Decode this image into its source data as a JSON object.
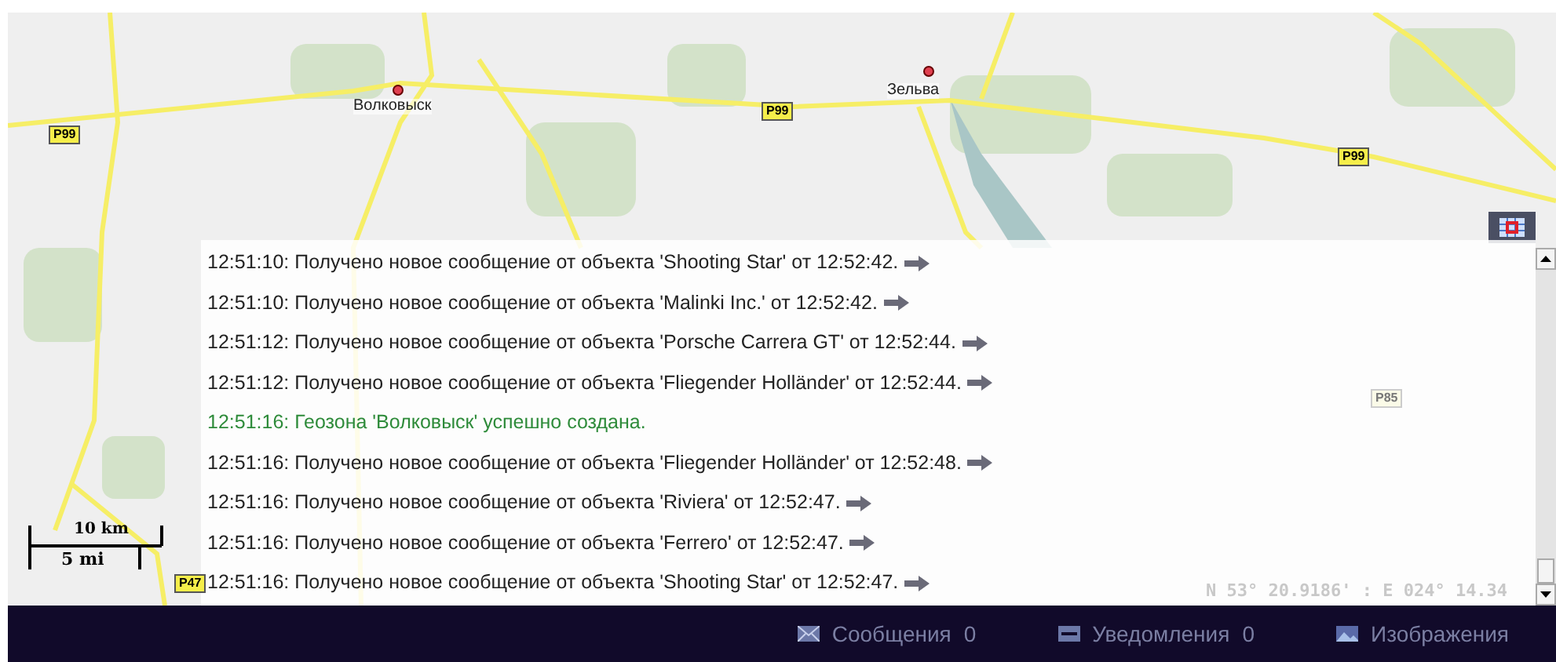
{
  "map": {
    "cities": [
      {
        "name": "Волковыск"
      },
      {
        "name": "Зельва"
      }
    ],
    "road_labels": [
      {
        "label": "P99"
      },
      {
        "label": "P99"
      },
      {
        "label": "P99"
      },
      {
        "label": "P47"
      },
      {
        "label": "P85"
      }
    ],
    "scale": {
      "metric": "10 km",
      "imperial": "5 mi"
    },
    "coordinates": "N 53° 20.9186' : E 024° 14.34"
  },
  "log": {
    "messages": [
      {
        "kind": "info",
        "text": "12:51:10: Получено новое сообщение от объекта 'Shooting Star' от 12:52:42."
      },
      {
        "kind": "info",
        "text": "12:51:10: Получено новое сообщение от объекта 'Malinki Inc.' от 12:52:42."
      },
      {
        "kind": "info",
        "text": "12:51:12: Получено новое сообщение от объекта 'Porsche Carrera GT' от 12:52:44."
      },
      {
        "kind": "info",
        "text": "12:51:12: Получено новое сообщение от объекта 'Fliegender Holländer' от 12:52:44."
      },
      {
        "kind": "success",
        "text": "12:51:16: Геозона 'Волковыск' успешно создана."
      },
      {
        "kind": "info",
        "text": "12:51:16: Получено новое сообщение от объекта 'Fliegender Holländer' от 12:52:48."
      },
      {
        "kind": "info",
        "text": "12:51:16: Получено новое сообщение от объекта 'Riviera' от 12:52:47."
      },
      {
        "kind": "info",
        "text": "12:51:16: Получено новое сообщение от объекта 'Ferrero' от 12:52:47."
      },
      {
        "kind": "info",
        "text": "12:51:16: Получено новое сообщение от объекта 'Shooting Star' от 12:52:47."
      }
    ]
  },
  "status_bar": [
    {
      "kind": "messages",
      "label": "Сообщения",
      "count": "0"
    },
    {
      "kind": "notifications",
      "label": "Уведомления",
      "count": "0"
    },
    {
      "kind": "images",
      "label": "Изображения"
    }
  ]
}
